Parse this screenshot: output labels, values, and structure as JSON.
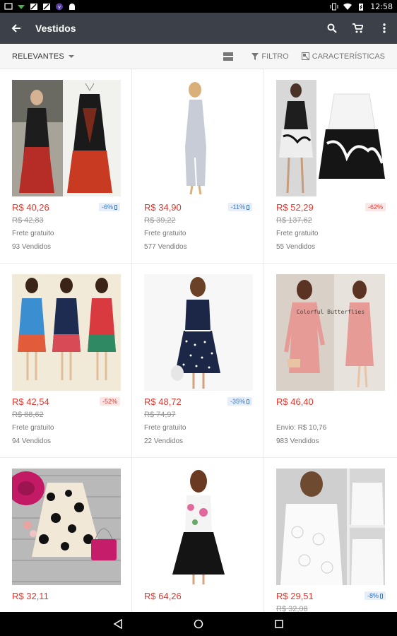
{
  "status": {
    "time": "12:58"
  },
  "appbar": {
    "title": "Vestidos"
  },
  "filter": {
    "sort_label": "RELEVANTES",
    "filter_label": "FILTRO",
    "features_label": "CARACTERÍSTICAS"
  },
  "products": [
    {
      "price": "R$ 40,26",
      "old_price": "R$ 42,83",
      "shipping": "Frete gratuito",
      "sold": "93 Vendidos",
      "discount": "-6%",
      "badge_style": "blue",
      "mobile_badge": true,
      "image": "two red patterned maxi dresses"
    },
    {
      "price": "R$ 34,90",
      "old_price": "R$ 39,22",
      "shipping": "Frete gratuito",
      "sold": "577 Vendidos",
      "discount": "-11%",
      "badge_style": "blue",
      "mobile_badge": true,
      "image": "light grey halter maxi dress"
    },
    {
      "price": "R$ 52,29",
      "old_price": "R$ 137,62",
      "shipping": "Frete gratuito",
      "sold": "55 Vendidos",
      "discount": "-62%",
      "badge_style": "red",
      "mobile_badge": false,
      "image": "black and white leaf print dresses"
    },
    {
      "price": "R$ 42,54",
      "old_price": "R$ 88,62",
      "shipping": "Frete gratuito",
      "sold": "94 Vendidos",
      "discount": "-52%",
      "badge_style": "red",
      "mobile_badge": false,
      "image": "three floral embroidered dresses"
    },
    {
      "price": "R$ 48,72",
      "old_price": "R$ 74,97",
      "shipping": "Frete gratuito",
      "sold": "22 Vendidos",
      "discount": "-35%",
      "badge_style": "blue",
      "mobile_badge": true,
      "image": "navy polka dot dress"
    },
    {
      "price": "R$ 46,40",
      "old_price": "",
      "shipping": "Envio: R$ 10,76",
      "sold": "983 Vendidos",
      "discount": "",
      "badge_style": "",
      "mobile_badge": false,
      "image": "pink lace long sleeve dresses",
      "watermark": "Colorful Butterflies"
    },
    {
      "price": "R$ 32,11",
      "old_price": "",
      "shipping": "",
      "sold": "",
      "discount": "",
      "badge_style": "",
      "mobile_badge": false,
      "image": "floral print dress with pink hat and bag"
    },
    {
      "price": "R$ 64,26",
      "old_price": "",
      "shipping": "",
      "sold": "",
      "discount": "",
      "badge_style": "",
      "mobile_badge": false,
      "image": "black skirt dress with floral top"
    },
    {
      "price": "R$ 29,51",
      "old_price": "R$ 32,08",
      "shipping": "",
      "sold": "",
      "discount": "-8%",
      "badge_style": "blue",
      "mobile_badge": true,
      "image": "white lace blouses"
    }
  ]
}
